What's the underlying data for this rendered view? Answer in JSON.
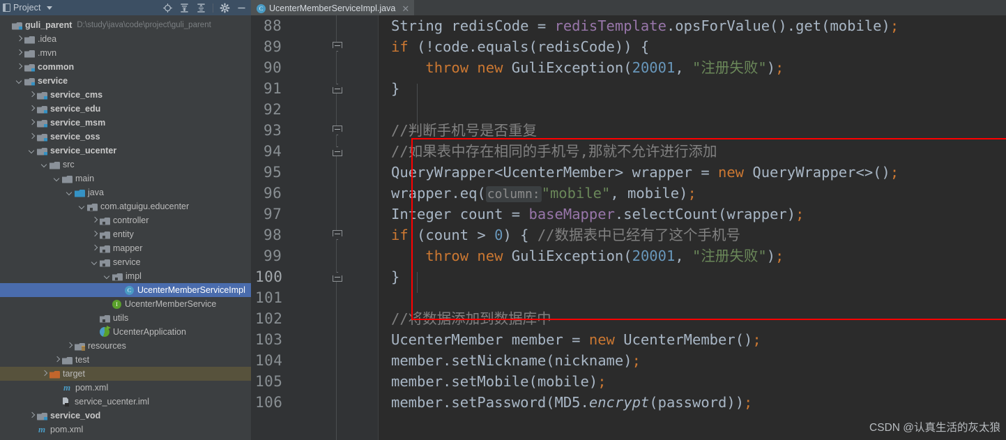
{
  "project_panel": {
    "title": "Project",
    "icons": [
      "panel-icon",
      "chevron-down-icon",
      "locate-target-icon",
      "expand-all-icon",
      "collapse-all-icon",
      "settings-gear-icon",
      "minimize-icon"
    ],
    "root": {
      "label": "guli_parent",
      "path": "D:\\study\\java\\code\\project\\guli_parent"
    },
    "tree": [
      {
        "label": ".idea",
        "indent": 1,
        "arrow": "right",
        "icon": "folder-icon"
      },
      {
        "label": ".mvn",
        "indent": 1,
        "arrow": "right",
        "icon": "folder-icon"
      },
      {
        "label": "common",
        "indent": 1,
        "arrow": "right",
        "icon": "module-icon",
        "bold": true
      },
      {
        "label": "service",
        "indent": 1,
        "arrow": "down",
        "icon": "module-icon",
        "bold": true
      },
      {
        "label": "service_cms",
        "indent": 2,
        "arrow": "right",
        "icon": "module-icon",
        "bold": true
      },
      {
        "label": "service_edu",
        "indent": 2,
        "arrow": "right",
        "icon": "module-icon",
        "bold": true
      },
      {
        "label": "service_msm",
        "indent": 2,
        "arrow": "right",
        "icon": "module-icon",
        "bold": true
      },
      {
        "label": "service_oss",
        "indent": 2,
        "arrow": "right",
        "icon": "module-icon",
        "bold": true
      },
      {
        "label": "service_ucenter",
        "indent": 2,
        "arrow": "down",
        "icon": "module-icon",
        "bold": true
      },
      {
        "label": "src",
        "indent": 3,
        "arrow": "down",
        "icon": "folder-icon"
      },
      {
        "label": "main",
        "indent": 4,
        "arrow": "down",
        "icon": "folder-icon"
      },
      {
        "label": "java",
        "indent": 5,
        "arrow": "down",
        "icon": "source-root-icon"
      },
      {
        "label": "com.atguigu.educenter",
        "indent": 6,
        "arrow": "down",
        "icon": "package-icon"
      },
      {
        "label": "controller",
        "indent": 7,
        "arrow": "right",
        "icon": "package-icon"
      },
      {
        "label": "entity",
        "indent": 7,
        "arrow": "right",
        "icon": "package-icon"
      },
      {
        "label": "mapper",
        "indent": 7,
        "arrow": "right",
        "icon": "package-icon"
      },
      {
        "label": "service",
        "indent": 7,
        "arrow": "down",
        "icon": "package-icon"
      },
      {
        "label": "impl",
        "indent": 8,
        "arrow": "down",
        "icon": "package-icon"
      },
      {
        "label": "UcenterMemberServiceImpl",
        "indent": 9,
        "arrow": "none",
        "icon": "java-class-icon",
        "selected": true
      },
      {
        "label": "UcenterMemberService",
        "indent": 8,
        "arrow": "none",
        "icon": "java-interface-icon"
      },
      {
        "label": "utils",
        "indent": 7,
        "arrow": "none",
        "icon": "package-icon"
      },
      {
        "label": "UcenterApplication",
        "indent": 7,
        "arrow": "none",
        "icon": "spring-app-icon"
      },
      {
        "label": "resources",
        "indent": 5,
        "arrow": "right",
        "icon": "resources-folder-icon"
      },
      {
        "label": "test",
        "indent": 4,
        "arrow": "right",
        "icon": "folder-icon"
      },
      {
        "label": "target",
        "indent": 3,
        "arrow": "right",
        "icon": "excluded-folder-icon",
        "target": true
      },
      {
        "label": "pom.xml",
        "indent": 4,
        "arrow": "none",
        "icon": "maven-icon"
      },
      {
        "label": "service_ucenter.iml",
        "indent": 4,
        "arrow": "none",
        "icon": "iml-module-file-icon"
      },
      {
        "label": "service_vod",
        "indent": 2,
        "arrow": "right",
        "icon": "module-icon",
        "bold": true
      },
      {
        "label": "pom.xml",
        "indent": 2,
        "arrow": "none",
        "icon": "maven-icon"
      }
    ]
  },
  "editor": {
    "tab": {
      "label": "UcenterMemberServiceImpl.java",
      "icon": "java-class-icon",
      "close_icon": "close-icon",
      "class_letter": "C"
    },
    "line_numbers": [
      "88",
      "89",
      "90",
      "91",
      "92",
      "93",
      "94",
      "95",
      "96",
      "97",
      "98",
      "99",
      "100",
      "101",
      "102",
      "103",
      "104",
      "105",
      "106"
    ],
    "lines": [
      {
        "n": "88",
        "tokens": [
          {
            "t": "String redisCode = ",
            "c": "txt"
          },
          {
            "t": "redisTemplate",
            "c": "fld"
          },
          {
            "t": ".opsForValue().get(mobile)",
            "c": "txt"
          },
          {
            "t": ";",
            "c": "kw"
          }
        ]
      },
      {
        "n": "89",
        "tokens": [
          {
            "t": "if",
            "c": "kw"
          },
          {
            "t": " (!code.equals(redisCode)) {",
            "c": "txt"
          }
        ]
      },
      {
        "n": "90",
        "tokens": [
          {
            "t": "    ",
            "c": "txt"
          },
          {
            "t": "throw new",
            "c": "kw"
          },
          {
            "t": " GuliException(",
            "c": "txt"
          },
          {
            "t": "20001",
            "c": "num"
          },
          {
            "t": ", ",
            "c": "txt"
          },
          {
            "t": "\"注册失败\"",
            "c": "str"
          },
          {
            "t": ")",
            "c": "txt"
          },
          {
            "t": ";",
            "c": "kw"
          }
        ]
      },
      {
        "n": "91",
        "tokens": [
          {
            "t": "}",
            "c": "txt"
          }
        ]
      },
      {
        "n": "92",
        "tokens": []
      },
      {
        "n": "93",
        "tokens": [
          {
            "t": "//判断手机号是否重复",
            "c": "cmt"
          }
        ]
      },
      {
        "n": "94",
        "tokens": [
          {
            "t": "//如果表中存在相同的手机号,那就不允许进行添加",
            "c": "cmt"
          }
        ]
      },
      {
        "n": "95",
        "tokens": [
          {
            "t": "QueryWrapper<UcenterMember> wrapper = ",
            "c": "txt"
          },
          {
            "t": "new",
            "c": "kw"
          },
          {
            "t": " QueryWrapper<>()",
            "c": "txt"
          },
          {
            "t": ";",
            "c": "kw"
          }
        ]
      },
      {
        "n": "96",
        "tokens": [
          {
            "t": "wrapper.eq(",
            "c": "txt"
          },
          {
            "t": "column:",
            "c": "hint"
          },
          {
            "t": "\"mobile\"",
            "c": "str"
          },
          {
            "t": ", mobile)",
            "c": "txt"
          },
          {
            "t": ";",
            "c": "kw"
          }
        ]
      },
      {
        "n": "97",
        "tokens": [
          {
            "t": "Integer count = ",
            "c": "txt"
          },
          {
            "t": "baseMapper",
            "c": "fld"
          },
          {
            "t": ".selectCount(wrapper)",
            "c": "txt"
          },
          {
            "t": ";",
            "c": "kw"
          }
        ]
      },
      {
        "n": "98",
        "tokens": [
          {
            "t": "if",
            "c": "kw"
          },
          {
            "t": " (count > ",
            "c": "txt"
          },
          {
            "t": "0",
            "c": "num"
          },
          {
            "t": ") { ",
            "c": "txt"
          },
          {
            "t": "//数据表中已经有了这个手机号",
            "c": "cmt"
          }
        ]
      },
      {
        "n": "99",
        "tokens": [
          {
            "t": "    ",
            "c": "txt"
          },
          {
            "t": "throw new",
            "c": "kw"
          },
          {
            "t": " GuliException(",
            "c": "txt"
          },
          {
            "t": "20001",
            "c": "num"
          },
          {
            "t": ", ",
            "c": "txt"
          },
          {
            "t": "\"注册失败\"",
            "c": "str"
          },
          {
            "t": ")",
            "c": "txt"
          },
          {
            "t": ";",
            "c": "kw"
          }
        ]
      },
      {
        "n": "100",
        "tokens": [
          {
            "t": "}",
            "c": "txt"
          }
        ]
      },
      {
        "n": "101",
        "tokens": []
      },
      {
        "n": "102",
        "tokens": [
          {
            "t": "//将数据添加到数据库中",
            "c": "cmt"
          }
        ]
      },
      {
        "n": "103",
        "tokens": [
          {
            "t": "UcenterMember member = ",
            "c": "txt"
          },
          {
            "t": "new",
            "c": "kw"
          },
          {
            "t": " UcenterMember()",
            "c": "txt"
          },
          {
            "t": ";",
            "c": "kw"
          }
        ]
      },
      {
        "n": "104",
        "tokens": [
          {
            "t": "member.setNickname(nickname)",
            "c": "txt"
          },
          {
            "t": ";",
            "c": "kw"
          }
        ]
      },
      {
        "n": "105",
        "tokens": [
          {
            "t": "member.setMobile(mobile)",
            "c": "txt"
          },
          {
            "t": ";",
            "c": "kw"
          }
        ]
      },
      {
        "n": "106",
        "tokens": [
          {
            "t": "member.setPassword(MD5.",
            "c": "txt"
          },
          {
            "t": "encrypt",
            "c": "stc"
          },
          {
            "t": "(password))",
            "c": "txt"
          },
          {
            "t": ";",
            "c": "kw"
          }
        ]
      }
    ],
    "highlight_box_color": "#ff0000",
    "fold_markers": [
      "89",
      "91",
      "93",
      "94",
      "100"
    ]
  },
  "watermark": "CSDN @认真生活的灰太狼"
}
